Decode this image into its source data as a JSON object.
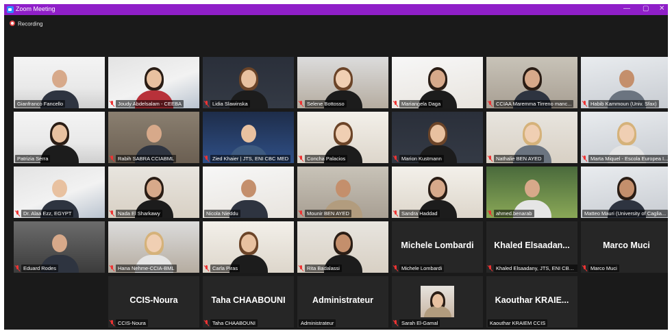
{
  "window": {
    "title": "Zoom Meeting"
  },
  "controls": {
    "minimize": "—",
    "maximize": "▢",
    "close": "✕"
  },
  "recording": {
    "label": "Recording"
  },
  "colors": {
    "titlebar": "#8f1fc8",
    "active_speaker_border": "#c8e53b",
    "muted_icon": "#e33333",
    "background": "#1a1a1a"
  },
  "participants": [
    {
      "name": "Gianfranco Fancello",
      "muted": false,
      "video": true,
      "active": true
    },
    {
      "name": "Joudy Abdelsalam - CEEBA",
      "muted": true,
      "video": true
    },
    {
      "name": "Lidia Slawinska",
      "muted": true,
      "video": true
    },
    {
      "name": "Selene Bottosso",
      "muted": true,
      "video": true
    },
    {
      "name": "Mariangela Daga",
      "muted": true,
      "video": true
    },
    {
      "name": "CCIAA Maremma Tirreno manc...",
      "muted": true,
      "video": true
    },
    {
      "name": "Habib Kammoun (Univ. Sfax)",
      "muted": true,
      "video": true
    },
    {
      "name": "Patrizia Serra",
      "muted": false,
      "video": true
    },
    {
      "name": "Rabih SABRA CCIABML",
      "muted": true,
      "video": true
    },
    {
      "name": "Zied Khaier | JTS, ENI CBC MED",
      "muted": true,
      "video": true
    },
    {
      "name": "Concha Palacios",
      "muted": true,
      "video": true
    },
    {
      "name": "Marion Kustmann",
      "muted": true,
      "video": true
    },
    {
      "name": "Nathalie BEN AYED",
      "muted": true,
      "video": true
    },
    {
      "name": "Marta Miquel - Escola Europea I...",
      "muted": true,
      "video": true
    },
    {
      "name": "Dr. Alaa Ezz, EGYPT",
      "muted": true,
      "video": true
    },
    {
      "name": "Nada El Sharkawy",
      "muted": true,
      "video": true
    },
    {
      "name": "Nicola Nieddu",
      "muted": false,
      "video": true
    },
    {
      "name": "Mounir BEN AYED",
      "muted": true,
      "video": true
    },
    {
      "name": "Sandra Haddad",
      "muted": true,
      "video": true
    },
    {
      "name": "ahmed.benarab",
      "muted": true,
      "video": true
    },
    {
      "name": "Matteo Mauri (University of Caglia...",
      "muted": false,
      "video": true
    },
    {
      "name": "Eduard Rodes",
      "muted": true,
      "video": true
    },
    {
      "name": "Hana Nehme-CCIA-BML",
      "muted": true,
      "video": true
    },
    {
      "name": "Carla Piras",
      "muted": true,
      "video": true
    },
    {
      "name": "Rita Badalassi",
      "muted": true,
      "video": true
    },
    {
      "name": "Michele Lombardi",
      "display": "Michele Lombardi",
      "muted": true,
      "video": false
    },
    {
      "name": "Khaled Elsaadany, JTS, ENI CBC ...",
      "display": "Khaled  Elsaadan...",
      "muted": true,
      "video": false
    },
    {
      "name": "Marco Muci",
      "display": "Marco Muci",
      "muted": true,
      "video": false
    },
    {
      "name": "CCIS-Noura",
      "display": "CCIS-Noura",
      "muted": true,
      "video": false
    },
    {
      "name": "Taha CHAABOUNI",
      "display": "Taha CHAABOUNI",
      "muted": true,
      "video": false
    },
    {
      "name": "Administrateur",
      "display": "Administrateur",
      "muted": false,
      "video": false
    },
    {
      "name": "Sarah El-Gamal",
      "muted": true,
      "video": false,
      "photo": true
    },
    {
      "name": "Kaouthar KRAIEM CCIS",
      "display": "Kaouthar  KRAIE...",
      "muted": false,
      "video": false
    }
  ]
}
